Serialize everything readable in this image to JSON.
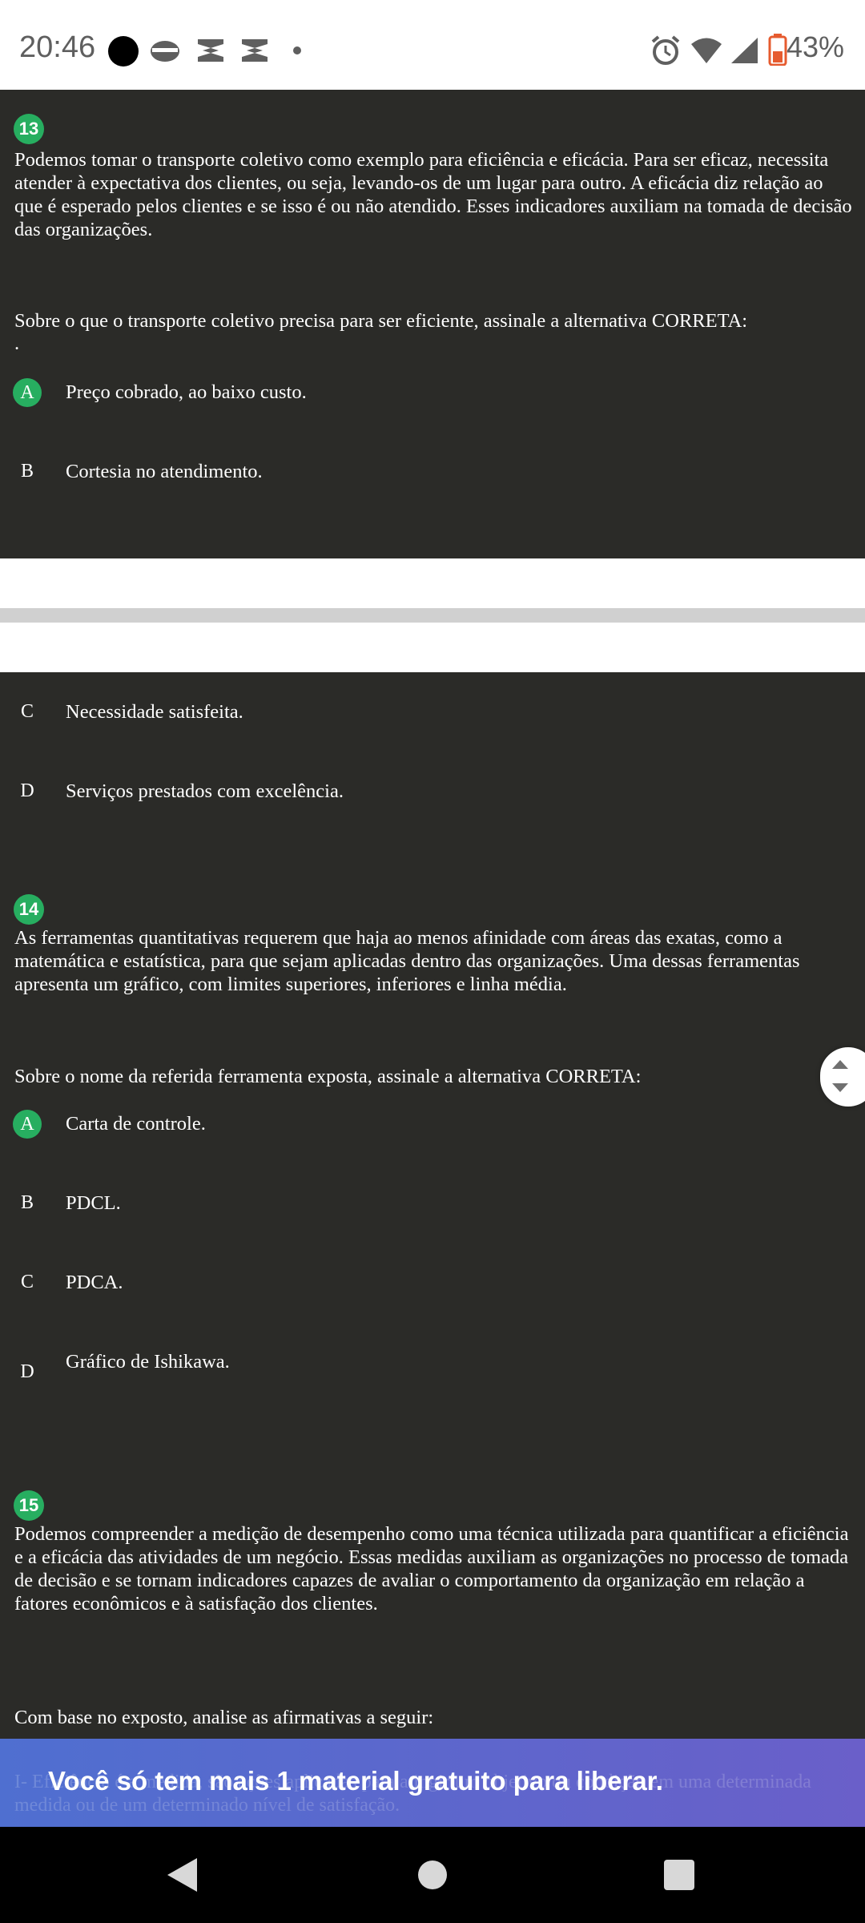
{
  "status_bar": {
    "time": "20:46",
    "battery": "43%",
    "icons": [
      "dot-icon",
      "mask-icon",
      "capcut-icon",
      "capcut-icon",
      "small-dot-icon",
      "alarm-icon",
      "wifi-icon",
      "signal-icon",
      "battery-icon"
    ]
  },
  "questions": [
    {
      "number": "13",
      "text": "Podemos tomar o transporte coletivo como exemplo para eficiência e eficácia. Para ser eficaz, necessita atender à expectativa dos clientes, ou seja, levando-os de um lugar para outro. A eficácia diz relação ao que é esperado pelos clientes e se isso é ou não atendido. Esses indicadores auxiliam na tomada de decisão das organizações.",
      "prompt": "Sobre o que o transporte coletivo precisa para ser eficiente, assinale a alternativa CORRETA:",
      "prompt_extra": ".",
      "options": [
        {
          "letter": "A",
          "text": "Preço cobrado, ao baixo custo.",
          "selected": true
        },
        {
          "letter": "B",
          "text": "Cortesia no atendimento.",
          "selected": false
        },
        {
          "letter": "C",
          "text": "Necessidade satisfeita.",
          "selected": false
        },
        {
          "letter": "D",
          "text": "Serviços prestados com excelência.",
          "selected": false
        }
      ]
    },
    {
      "number": "14",
      "text": "As ferramentas quantitativas requerem que haja ao menos afinidade com áreas das exatas, como a matemática e estatística, para que sejam aplicadas dentro das organizações. Uma dessas ferramentas apresenta um gráfico, com limites superiores, inferiores e linha média.",
      "prompt": "Sobre o nome da referida ferramenta exposta, assinale a alternativa CORRETA:",
      "options": [
        {
          "letter": "A",
          "text": "Carta de controle.",
          "selected": true
        },
        {
          "letter": "B",
          "text": "PDCL.",
          "selected": false
        },
        {
          "letter": "C",
          "text": "PDCA.",
          "selected": false
        },
        {
          "letter": "D",
          "text": "Gráfico de Ishikawa.",
          "selected": false
        }
      ]
    },
    {
      "number": "15",
      "text": "Podemos compreender a medição de desempenho como uma técnica utilizada para quantificar a eficiência e a eficácia das atividades de um negócio. Essas medidas auxiliam as organizações no processo de tomada de decisão e se tornam indicadores capazes de avaliar o comportamento da organização em relação a fatores econômicos e à satisfação dos clientes.",
      "prompt": "Com base no exposto, analise as afirmativas a seguir:"
    }
  ],
  "banner": {
    "message": "Você só tem mais 1 material gratuito para liberar.",
    "ghost_text": "I- Eficiência é a medida, são ações aplicadas para atingir um objetivo ou condição em uma determinada medida ou de um determinado nível de satisfação."
  },
  "colors": {
    "accent_green": "#27ae60",
    "panel_bg": "#2b2b28",
    "banner_start": "#4f6fd0",
    "banner_end": "#6a5fc9"
  }
}
